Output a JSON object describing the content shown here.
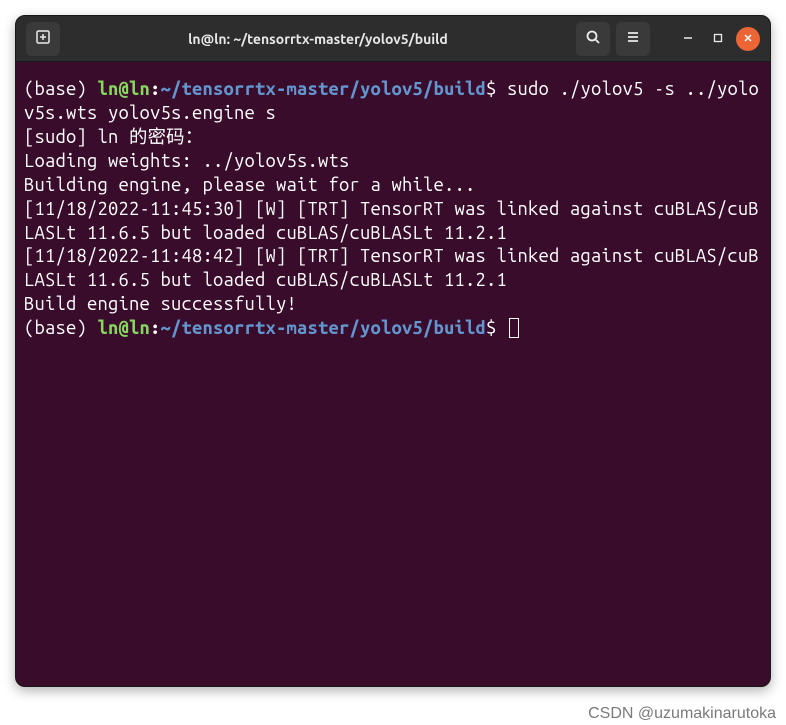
{
  "window": {
    "title": "ln@ln: ~/tensorrtx-master/yolov5/build"
  },
  "prompt": {
    "env": "(base) ",
    "user": "ln",
    "at": "@",
    "host": "ln",
    "colon": ":",
    "path": "~/tensorrtx-master/yolov5/build",
    "dollar": "$"
  },
  "terminal": {
    "command1": " sudo ./yolov5 -s ../yolov5s.wts yolov5s.engine s",
    "line_sudo": "[sudo] ln 的密码：",
    "line_loading": "Loading weights: ../yolov5s.wts",
    "line_building": "Building engine, please wait for a while...",
    "line_w1": "[11/18/2022-11:45:30] [W] [TRT] TensorRT was linked against cuBLAS/cuBLASLt 11.6.5 but loaded cuBLAS/cuBLASLt 11.2.1",
    "line_w2": "[11/18/2022-11:48:42] [W] [TRT] TensorRT was linked against cuBLAS/cuBLASLt 11.6.5 but loaded cuBLAS/cuBLASLt 11.2.1",
    "line_success": "Build engine successfully!"
  },
  "icons": {
    "newtab": "new-tab-icon",
    "search": "search-icon",
    "menu": "hamburger-icon",
    "minimize": "minimize-icon",
    "maximize": "maximize-icon",
    "close": "close-icon"
  },
  "watermark": "CSDN @uzumakinarutoka"
}
